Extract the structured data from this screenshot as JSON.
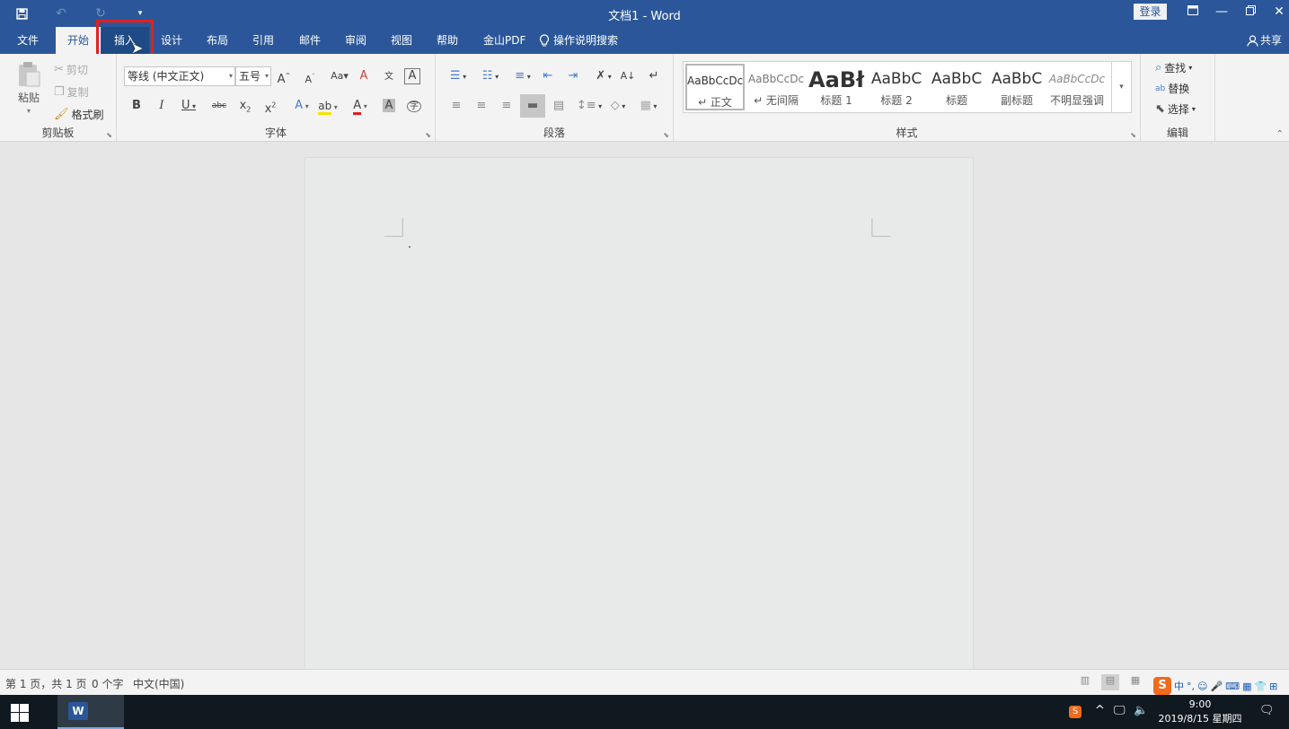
{
  "window": {
    "title": "文档1  -  Word",
    "login_label": "登录",
    "share_label": "共享"
  },
  "tabs": [
    {
      "label": "文件"
    },
    {
      "label": "开始"
    },
    {
      "label": "插入"
    },
    {
      "label": "设计"
    },
    {
      "label": "布局"
    },
    {
      "label": "引用"
    },
    {
      "label": "邮件"
    },
    {
      "label": "审阅"
    },
    {
      "label": "视图"
    },
    {
      "label": "帮助"
    },
    {
      "label": "金山PDF"
    }
  ],
  "tell_me": "操作说明搜索",
  "clipboard": {
    "paste": "粘贴",
    "cut": "剪切",
    "copy": "复制",
    "format_painter": "格式刷",
    "group_label": "剪贴板"
  },
  "font": {
    "font_name": "等线 (中文正文)",
    "font_size": "五号",
    "group_label": "字体"
  },
  "paragraph": {
    "group_label": "段落"
  },
  "styles": {
    "group_label": "样式",
    "items": [
      {
        "preview": "AaBbCcDc",
        "name": "↵ 正文"
      },
      {
        "preview": "AaBbCcDc",
        "name": "↵ 无间隔"
      },
      {
        "preview": "AaBł",
        "name": "标题 1"
      },
      {
        "preview": "AaBbC",
        "name": "标题 2"
      },
      {
        "preview": "AaBbC",
        "name": "标题"
      },
      {
        "preview": "AaBbC",
        "name": "副标题"
      },
      {
        "preview": "AaBbCcDc",
        "name": "不明显强调"
      }
    ]
  },
  "editing": {
    "find": "查找",
    "replace": "替换",
    "select": "选择",
    "group_label": "编辑"
  },
  "status": {
    "page": "第 1 页，共 1 页",
    "words": "0 个字",
    "language": "中文(中国)"
  },
  "taskbar": {
    "time": "9:00",
    "date": "2019/8/15 星期四",
    "ime_mode": "中"
  },
  "colors": {
    "accent": "#2b579a",
    "highlight_box": "#e02020"
  }
}
